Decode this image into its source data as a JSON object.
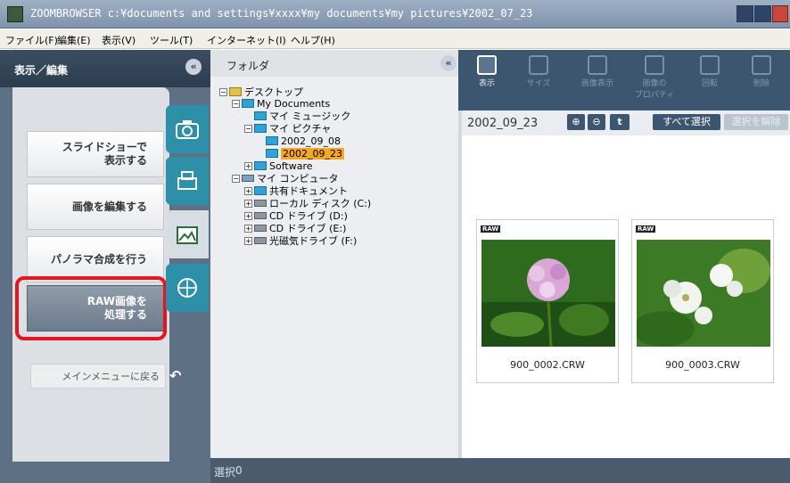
{
  "window": {
    "title": "ZOOMBROWSER c:¥documents and settings¥xxxx¥my documents¥my pictures¥2002_07_23"
  },
  "menubar": [
    "ファイル(F)",
    "編集(E)",
    "表示(V)",
    "ツール(T)",
    "インターネット(I)",
    "ヘルプ(H)"
  ],
  "left_panel": {
    "title": "表示／編集",
    "buttons": {
      "slideshow": "スライドショーで\n表示する",
      "edit": "画像を編集する",
      "panorama": "パノラマ合成を行う",
      "raw": "RAW画像を\n処理する"
    },
    "back": "メインメニューに戻る"
  },
  "folder_panel": {
    "title": "フォルダ",
    "tree": {
      "desktop": "デスクトップ",
      "my_documents": "My Documents",
      "my_music": "マイ ミュージック",
      "my_pictures": "マイ ピクチャ",
      "f_0808": "2002_09_08",
      "f_0823": "2002_09_23",
      "software": "Software",
      "my_computer": "マイ コンピュータ",
      "shared_docs": "共有ドキュメント",
      "local_disk": "ローカル ディスク (C:)",
      "cd_d": "CD ドライブ (D:)",
      "cd_e": "CD ドライブ (E:)",
      "mo_f": "光磁気ドライブ (F:)"
    }
  },
  "toolbar": {
    "view": "表示",
    "size": "サイズ",
    "image_view": "画像表示",
    "image_props": "画像の\nプロパティ",
    "rotate": "回転",
    "delete": "削除"
  },
  "content": {
    "current_folder": "2002_09_23",
    "select_all": "すべて選択",
    "deselect": "選択を解除",
    "up_symbol": "t",
    "zoom_in_symbol": "⊕",
    "zoom_out_symbol": "⊖",
    "thumbnails": [
      {
        "badge": "RAW",
        "filename": "900_0002.CRW"
      },
      {
        "badge": "RAW",
        "filename": "900_0003.CRW"
      }
    ]
  },
  "status": {
    "label": "選択",
    "count": "0"
  }
}
